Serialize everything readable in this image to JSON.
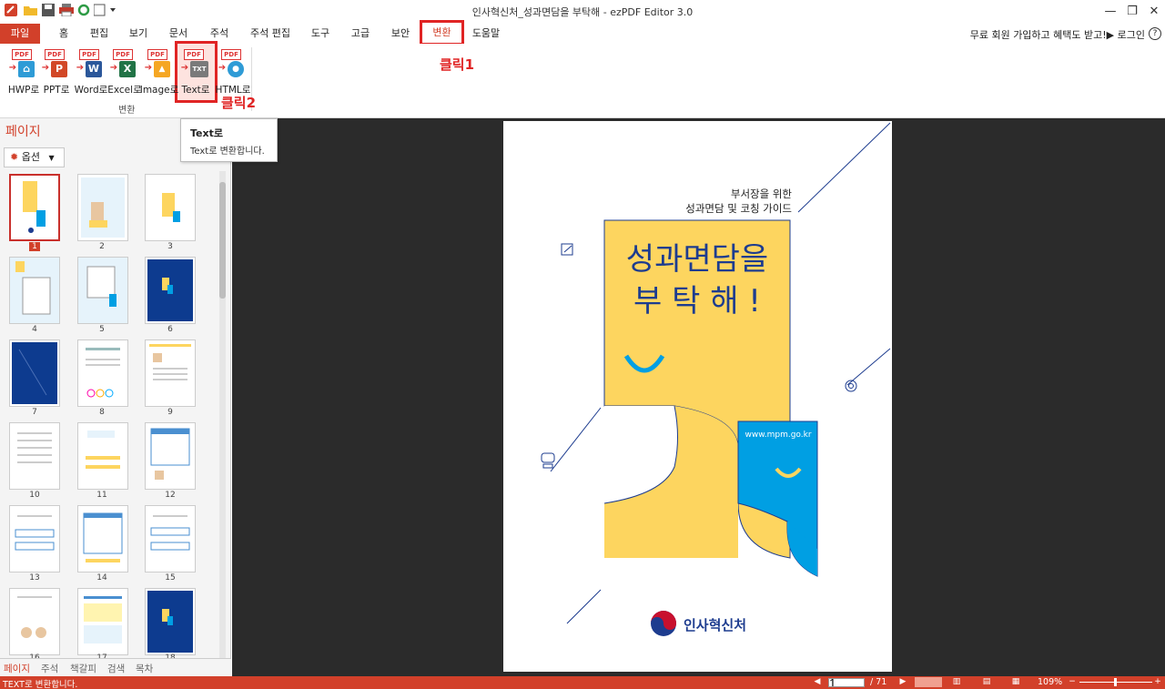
{
  "window": {
    "title": "인사혁신처_성과면담을 부탁해 - ezPDF Editor 3.0",
    "minimize": "—",
    "restore": "❐",
    "close": "✕"
  },
  "menu": {
    "file": "파일",
    "tabs": [
      "홈",
      "편집",
      "보기",
      "문서",
      "주석",
      "주석 편집",
      "도구",
      "고급",
      "보안",
      "변환",
      "도움말"
    ],
    "active_tab": "변환",
    "account_text": "무료 회원 가입하고 혜택도 받고!▶ 로그인",
    "help": "?"
  },
  "ribbon": {
    "buttons": [
      {
        "label": "HWP로",
        "badge": "PDF",
        "icon": "hwp-icon",
        "color": "#2e9bd6",
        "glyph": "⌂"
      },
      {
        "label": "PPT로",
        "badge": "PDF",
        "icon": "ppt-icon",
        "color": "#d24726",
        "glyph": "P"
      },
      {
        "label": "Word로",
        "badge": "PDF",
        "icon": "word-icon",
        "color": "#2b579a",
        "glyph": "W"
      },
      {
        "label": "Excel로",
        "badge": "PDF",
        "icon": "excel-icon",
        "color": "#217346",
        "glyph": "X"
      },
      {
        "label": "Image로",
        "badge": "PDF",
        "icon": "image-icon",
        "color": "#f5a623",
        "glyph": "▲"
      },
      {
        "label": "Text로",
        "badge": "PDF",
        "icon": "text-icon",
        "color": "#7a7a7a",
        "glyph": "TXT"
      },
      {
        "label": "HTML로",
        "badge": "PDF",
        "icon": "html-icon",
        "color": "#2e9bd6",
        "glyph": "●"
      }
    ],
    "group_label": "변환",
    "annotation_1": "클릭1",
    "annotation_2": "클릭2"
  },
  "tooltip": {
    "title": "Text로",
    "description": "Text로 변환합니다."
  },
  "left_panel": {
    "title": "페이지",
    "options_label": "옵션",
    "thumbnails": [
      "1",
      "2",
      "3",
      "4",
      "5",
      "6",
      "7",
      "8",
      "9",
      "10",
      "11",
      "12",
      "13",
      "14",
      "15",
      "16",
      "17",
      "18"
    ],
    "selected_page": "1",
    "bottom_tabs": [
      "페이지",
      "주석",
      "책갈피",
      "검색",
      "목차"
    ]
  },
  "document": {
    "subtitle_line1": "부서장을 위한",
    "subtitle_line2": "성과면담 및 코칭 가이드",
    "headline_line1": "성과면담을",
    "headline_line2": "부 탁 해 !",
    "url": "www.mpm.go.kr",
    "org_name": "인사혁신처",
    "colors": {
      "yellow": "#fdd55f",
      "blue": "#009fe3",
      "navy": "#1d3c8f"
    }
  },
  "status": {
    "message": "TEXT로 변환합니다.",
    "current_page": "1",
    "total_pages": "/ 71",
    "zoom": "109%"
  }
}
